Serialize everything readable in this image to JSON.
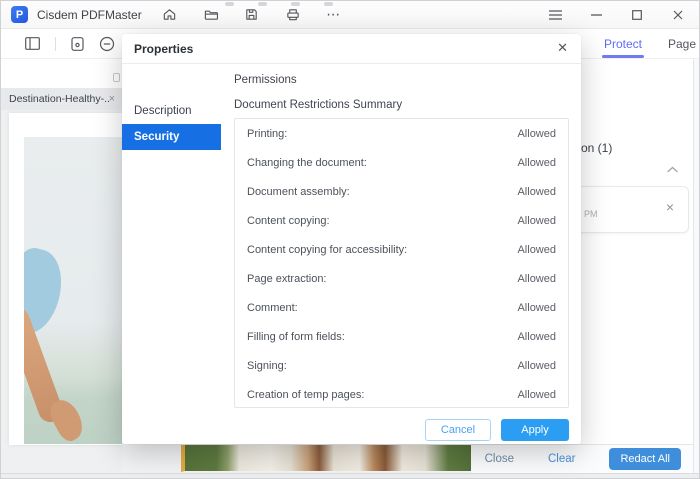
{
  "titlebar": {
    "logo_letter": "P",
    "app_title": "Cisdem PDFMaster",
    "more_icon_glyph": "⋯"
  },
  "toolbar": {
    "protect_tab": "Protect",
    "page_tab": "Page"
  },
  "document": {
    "tab_label": "Destination-Healthy-...",
    "tab_close_glyph": "×"
  },
  "right_panel": {
    "count_text_partial": "on (1)",
    "card_time_partial": "PM",
    "card_close_glyph": "×"
  },
  "bottom_bar": {
    "close_label": "Close",
    "clear_label": "Clear",
    "redact_all_label": "Redact All"
  },
  "dialog": {
    "title": "Properties",
    "close_glyph": "✕",
    "tabs": [
      {
        "label": "Description",
        "active": false
      },
      {
        "label": "Security",
        "active": true
      }
    ],
    "permissions_heading": "Permissions",
    "summary_heading": "Document Restrictions Summary",
    "restrictions": [
      {
        "label": "Printing:",
        "value": "Allowed"
      },
      {
        "label": "Changing the document:",
        "value": "Allowed"
      },
      {
        "label": "Document assembly:",
        "value": "Allowed"
      },
      {
        "label": "Content copying:",
        "value": "Allowed"
      },
      {
        "label": "Content copying for accessibility:",
        "value": "Allowed"
      },
      {
        "label": "Page extraction:",
        "value": "Allowed"
      },
      {
        "label": "Comment:",
        "value": "Allowed"
      },
      {
        "label": "Filling of form fields:",
        "value": "Allowed"
      },
      {
        "label": "Signing:",
        "value": "Allowed"
      },
      {
        "label": "Creation of temp pages:",
        "value": "Allowed"
      }
    ],
    "cancel_label": "Cancel",
    "apply_label": "Apply"
  },
  "colors": {
    "security_tab_active": "#1670e3",
    "apply_button": "#2b9ef3",
    "redact_button": "#3f8edb",
    "protect_accent": "#5f6cf4",
    "title_logo": "#2e66e8"
  }
}
